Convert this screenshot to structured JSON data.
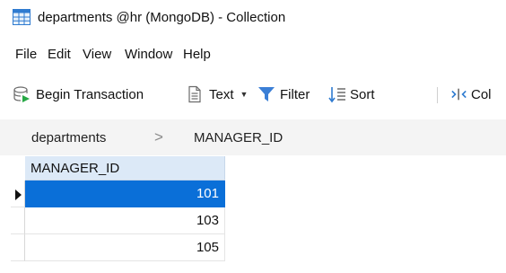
{
  "window": {
    "title": "departments @hr (MongoDB) - Collection",
    "icon": "table-grid-icon"
  },
  "menu": {
    "items": [
      {
        "label": "File"
      },
      {
        "label": "Edit"
      },
      {
        "label": "View"
      },
      {
        "label": "Window"
      },
      {
        "label": "Help"
      }
    ]
  },
  "toolbar": {
    "begin_transaction": "Begin Transaction",
    "text": "Text",
    "filter": "Filter",
    "sort": "Sort",
    "columns_partial": "Col"
  },
  "breadcrumb": {
    "collection": "departments",
    "separator": ">",
    "field": "MANAGER_ID"
  },
  "grid": {
    "column_header": "MANAGER_ID",
    "rows": [
      {
        "value": "101",
        "selected": true
      },
      {
        "value": "103",
        "selected": false
      },
      {
        "value": "105",
        "selected": false
      }
    ]
  },
  "colors": {
    "selection": "#0a6fd8",
    "header_bg": "#dce9f7",
    "breadcrumb_bg": "#f4f4f4",
    "filter_icon": "#3b7fd6"
  }
}
